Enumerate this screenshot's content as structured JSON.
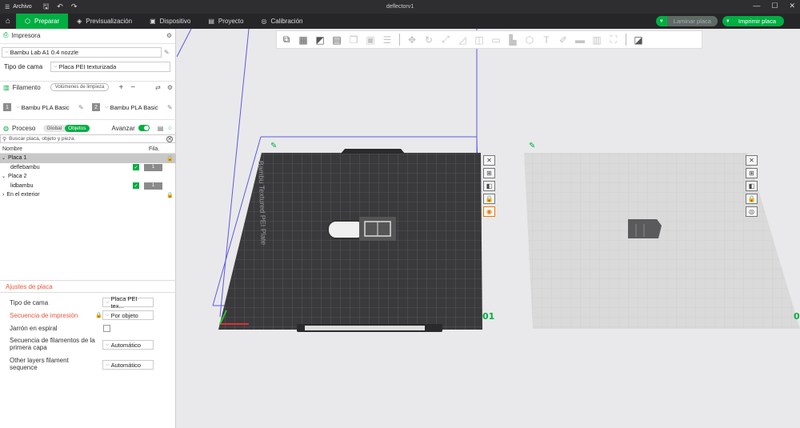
{
  "window": {
    "title": "deflectorv1",
    "menu_label": "Archivo"
  },
  "nav": {
    "tabs": [
      {
        "label": "Preparar",
        "icon": "cube-icon"
      },
      {
        "label": "Previsualización",
        "icon": "layers-icon"
      },
      {
        "label": "Dispositivo",
        "icon": "device-icon"
      },
      {
        "label": "Proyecto",
        "icon": "project-icon"
      },
      {
        "label": "Calibración",
        "icon": "calibration-icon"
      }
    ],
    "slice_label": "Laminar placa",
    "print_label": "Imprimir placa"
  },
  "printer": {
    "header": "Impresora",
    "name": "Bambu Lab A1 0.4 nozzle",
    "bed_type_label": "Tipo de cama",
    "bed_type": "Placa PEI texturizada"
  },
  "filament": {
    "header": "Filamento",
    "flush_button": "Volúmenes de limpieza",
    "slots": [
      {
        "index": "1",
        "name": "Bambu PLA Basic"
      },
      {
        "index": "2",
        "name": "Bambu PLA Basic"
      }
    ]
  },
  "process": {
    "header": "Proceso",
    "global_label": "Global",
    "objects_label": "Objetos",
    "advanced_label": "Avanzar",
    "search_placeholder": "Buscar placa, objeto y pieza."
  },
  "objects": {
    "col_name": "Nombre",
    "col_fila": "Fila.",
    "rows": [
      {
        "label": "Placa 1",
        "type": "plate"
      },
      {
        "label": "deflebambu",
        "type": "object",
        "filament": "1"
      },
      {
        "label": "Placa 2",
        "type": "plate"
      },
      {
        "label": "lidbambu",
        "type": "object",
        "filament": "1"
      },
      {
        "label": "En el exterior",
        "type": "group"
      }
    ]
  },
  "plate_settings": {
    "title": "Ajustes de placa",
    "rows": [
      {
        "label": "Tipo de cama",
        "value": "Placa PEI tex..."
      },
      {
        "label": "Secuencia de impresión",
        "value": "Por objeto"
      },
      {
        "label": "Jarrón en espiral",
        "value": ""
      },
      {
        "label": "Secuencia de filamentos de la primera capa",
        "value": "Automático"
      },
      {
        "label": "Other layers filament sequence",
        "value": "Automático"
      }
    ]
  },
  "viewport": {
    "plate1_text": "Bambu Textured PEI Plate",
    "plate1_num": "01",
    "plate2_num": "0"
  },
  "colors": {
    "accent": "#00ae42",
    "warning": "#e8573e",
    "bed_dark": "#3a3a3c",
    "bed_light": "#dcdcdc",
    "build_volume": "#5a5ae6"
  }
}
